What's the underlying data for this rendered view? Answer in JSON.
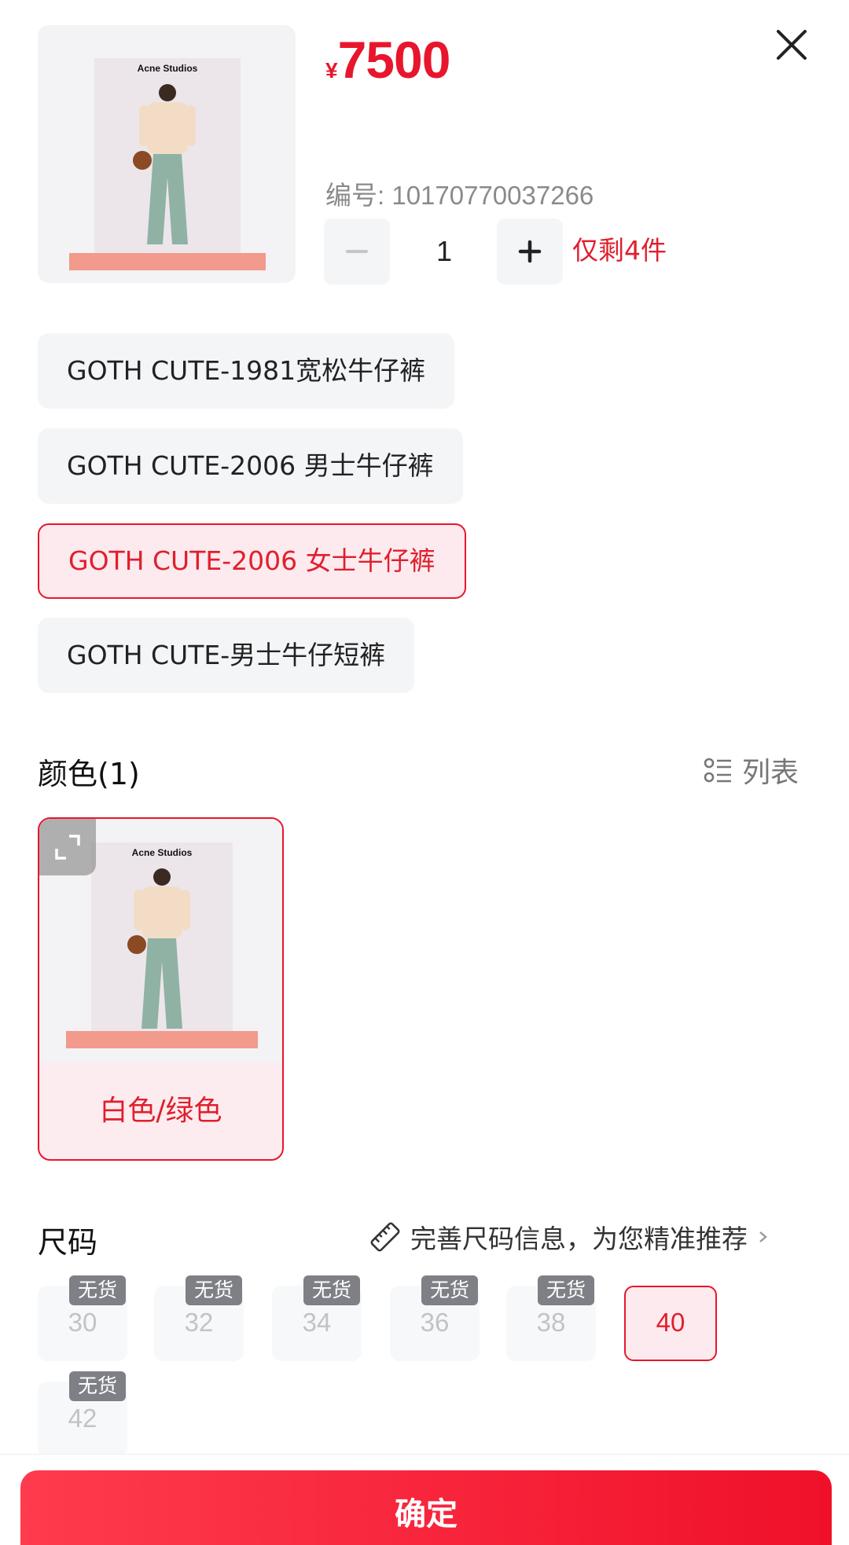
{
  "product": {
    "brand_on_image": "Acne Studios",
    "price_currency": "¥",
    "price_value": "7500",
    "sku_text": "编号: 10170770037266",
    "quantity": "1",
    "stock_note": "仅剩4件"
  },
  "variants": [
    {
      "label": "GOTH CUTE-1981宽松牛仔裤",
      "selected": false
    },
    {
      "label": "GOTH CUTE-2006 男士牛仔裤",
      "selected": false
    },
    {
      "label": "GOTH CUTE-2006 女士牛仔裤",
      "selected": true
    },
    {
      "label": "GOTH CUTE-男士牛仔短裤",
      "selected": false
    }
  ],
  "color_section": {
    "title": "颜色(1)",
    "list_toggle_label": "列表",
    "options": [
      {
        "label": "白色/绿色",
        "selected": true
      }
    ]
  },
  "size_section": {
    "title": "尺码",
    "hint": "完善尺码信息，为您精准推荐",
    "out_of_stock_badge": "无货",
    "sizes": [
      {
        "label": "30",
        "available": false
      },
      {
        "label": "32",
        "available": false
      },
      {
        "label": "34",
        "available": false
      },
      {
        "label": "36",
        "available": false
      },
      {
        "label": "38",
        "available": false
      },
      {
        "label": "40",
        "available": true,
        "selected": true
      },
      {
        "label": "42",
        "available": false
      }
    ]
  },
  "confirm_label": "确定",
  "colors": {
    "accent": "#e8162c",
    "selected_bg": "#fdeaee",
    "chip_bg": "#f4f5f7",
    "badge_bg": "#7e8086"
  }
}
